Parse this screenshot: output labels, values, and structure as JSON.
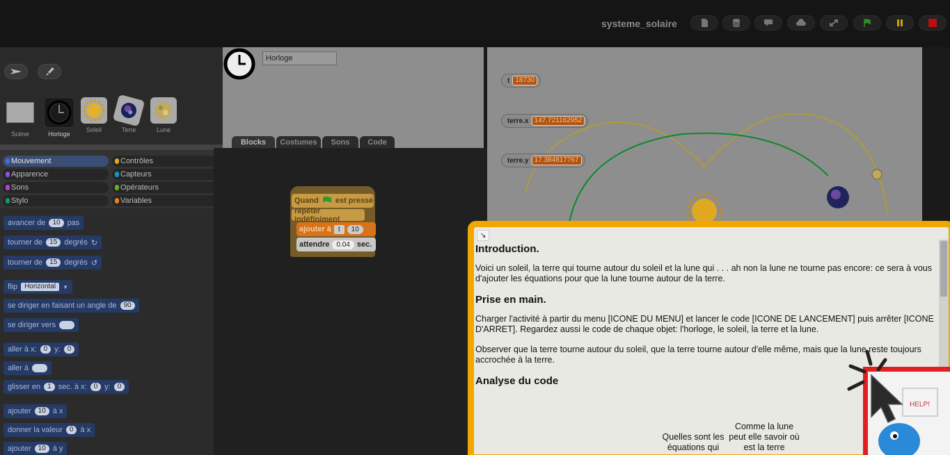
{
  "topbar": {
    "project_title": "systeme_solaire",
    "buttons": [
      "file-icon",
      "database-icon",
      "comment-icon",
      "cloud-icon",
      "fullscreen-icon",
      "green-flag-icon",
      "pause-icon",
      "stop-icon"
    ]
  },
  "corral": {
    "sprites": [
      {
        "label": "Scène"
      },
      {
        "label": "Horloge",
        "selected": true
      },
      {
        "label": "Soleil"
      },
      {
        "label": "Terre"
      },
      {
        "label": "Lune"
      }
    ]
  },
  "categories": {
    "items": [
      "Mouvement",
      "Contrôles",
      "Apparence",
      "Capteurs",
      "Sons",
      "Opérateurs",
      "Stylo",
      "Variables"
    ],
    "selected": "Mouvement",
    "colors": [
      "#4a6cd4",
      "#e1a91a",
      "#8a55d7",
      "#0e9ac4",
      "#bb42c3",
      "#5cb712",
      "#0e9a6c",
      "#ee7d16"
    ]
  },
  "palette": {
    "move": {
      "a": "avancer de",
      "v": "10",
      "b": "pas"
    },
    "turn_cw": {
      "a": "tourner de",
      "v": "15",
      "b": "degrés"
    },
    "turn_ccw": {
      "a": "tourner de",
      "v": "15",
      "b": "degrés"
    },
    "flip": {
      "a": "flip",
      "v": "Horizontal"
    },
    "point_dir": {
      "a": "se diriger en faisant un angle de",
      "v": "90"
    },
    "point_towards": {
      "a": "se diriger vers"
    },
    "goto_xy": {
      "a": "aller à x:",
      "x": "0",
      "y_label": "y:",
      "y": "0"
    },
    "goto": {
      "a": "aller à"
    },
    "glide": {
      "a": "glisser en",
      "v": "1",
      "b": "sec. à x:",
      "x": "0",
      "y_label": "y:",
      "y": "0"
    },
    "change_x": {
      "a": "ajouter",
      "v": "10",
      "b": "à x"
    },
    "set_x": {
      "a": "donner la valeur",
      "v": "0",
      "b": "à x"
    },
    "change_y": {
      "a": "ajouter",
      "v": "10",
      "b": "à y"
    }
  },
  "sprite_name": "Horloge",
  "tabs": [
    "Blocks",
    "Costumes",
    "Sons",
    "Code"
  ],
  "script": {
    "hat_a": "Quand",
    "hat_b": "est pressé",
    "forever": "répéter indéfiniment",
    "change_a": "ajouter à",
    "change_var": "t",
    "change_val": "10",
    "wait_a": "attendre",
    "wait_val": "0.04",
    "wait_b": "sec."
  },
  "stage": {
    "watchers": [
      {
        "name": "t",
        "value": "18730"
      },
      {
        "name": "terre.x",
        "value": "147.721162952"
      },
      {
        "name": "terre.y",
        "value": "17.384817767"
      }
    ]
  },
  "help": {
    "h1": "Introduction.",
    "p1": "Voici un soleil, la terre qui tourne autour du soleil et la lune qui . . . ah non la lune ne tourne pas encore: ce sera à vous d'ajouter les équations pour que la lune tourne autour de la terre.",
    "h2": "Prise en main.",
    "p2": "Charger l'activité à partir du menu [ICONE DU MENU] et lancer le code [ICONE DE LANCEMENT] puis arrêter [ICONE D'ARRET]. Regardez aussi le code de chaque objet: l'horloge, le soleil, la terre et la lune.",
    "p3": "Observer que la terre tourne autour du soleil, que la terre tourne autour d'elle même, mais que la lune reste toujours accrochée à la terre.",
    "h3": "Analyse du code",
    "col1": "Quelles sont les équations qui",
    "col2": "Comme la lune peut elle savoir où est la terre",
    "sign": "HELP!"
  }
}
